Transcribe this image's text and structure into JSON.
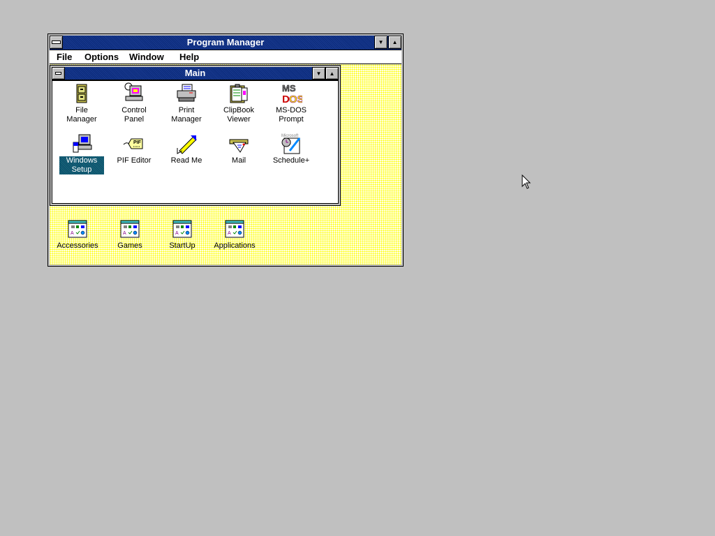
{
  "program_manager": {
    "title": "Program Manager",
    "menu": [
      "File",
      "Options",
      "Window",
      "Help"
    ]
  },
  "main_group": {
    "title": "Main",
    "items": [
      {
        "label": "File Manager",
        "icon": "file-cabinet-icon"
      },
      {
        "label": "Control Panel",
        "icon": "control-panel-icon"
      },
      {
        "label": "Print Manager",
        "icon": "printer-icon"
      },
      {
        "label": "ClipBook Viewer",
        "icon": "clipbook-icon"
      },
      {
        "label": "MS-DOS Prompt",
        "icon": "msdos-icon"
      },
      {
        "label": "Windows Setup",
        "icon": "windows-setup-icon",
        "selected": true
      },
      {
        "label": "PIF Editor",
        "icon": "pif-tag-icon"
      },
      {
        "label": "Read Me",
        "icon": "pen-icon"
      },
      {
        "label": "Mail",
        "icon": "mail-icon"
      },
      {
        "label": "Schedule+",
        "icon": "schedule-icon"
      }
    ]
  },
  "group_icons": [
    "Accessories",
    "Games",
    "StartUp",
    "Applications"
  ],
  "colors": {
    "title_bar": "#1a3a8f",
    "selection": "#0a5a64",
    "desktop": "#c0c0c0"
  }
}
